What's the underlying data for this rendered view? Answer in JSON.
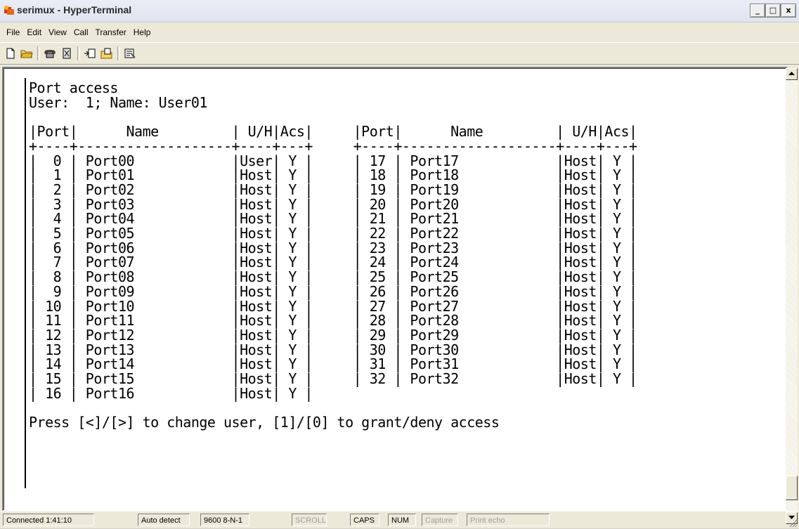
{
  "window": {
    "title": "serimux - HyperTerminal",
    "minimize": "_",
    "maximize": "□",
    "close": "x"
  },
  "menu": [
    "File",
    "Edit",
    "View",
    "Call",
    "Transfer",
    "Help"
  ],
  "toolbar": {
    "buttons": [
      {
        "name": "new-connection-icon"
      },
      {
        "name": "open-folder-icon"
      },
      {
        "name": "call-phone-icon"
      },
      {
        "name": "disconnect-icon"
      },
      {
        "name": "send-file-icon"
      },
      {
        "name": "receive-file-icon"
      },
      {
        "name": "properties-icon"
      }
    ]
  },
  "terminal": {
    "lines": [
      "Port access",
      "User:  1; Name: User01",
      "",
      "|Port|      Name         | U/H|Acs|     |Port|      Name         | U/H|Acs|",
      "+----+-------------------+----+---+     +----+-------------------+----+---+",
      "|  0 | Port00            |User| Y |     | 17 | Port17            |Host| Y |",
      "|  1 | Port01            |Host| Y |     | 18 | Port18            |Host| Y |",
      "|  2 | Port02            |Host| Y |     | 19 | Port19            |Host| Y |",
      "|  3 | Port03            |Host| Y |     | 20 | Port20            |Host| Y |",
      "|  4 | Port04            |Host| Y |     | 21 | Port21            |Host| Y |",
      "|  5 | Port05            |Host| Y |     | 22 | Port22            |Host| Y |",
      "|  6 | Port06            |Host| Y |     | 23 | Port23            |Host| Y |",
      "|  7 | Port07            |Host| Y |     | 24 | Port24            |Host| Y |",
      "|  8 | Port08            |Host| Y |     | 25 | Port25            |Host| Y |",
      "|  9 | Port09            |Host| Y |     | 26 | Port26            |Host| Y |",
      "| 10 | Port10            |Host| Y |     | 27 | Port27            |Host| Y |",
      "| 11 | Port11            |Host| Y |     | 28 | Port28            |Host| Y |",
      "| 12 | Port12            |Host| Y |     | 29 | Port29            |Host| Y |",
      "| 13 | Port13            |Host| Y |     | 30 | Port30            |Host| Y |",
      "| 14 | Port14            |Host| Y |     | 31 | Port31            |Host| Y |",
      "| 15 | Port15            |Host| Y |     | 32 | Port32            |Host| Y |",
      "| 16 | Port16            |Host| Y |",
      "",
      "Press [<]/[>] to change user, [1]/[0] to grant/deny access"
    ]
  },
  "statusbar": {
    "connected": "Connected 1:41:10",
    "detect": "Auto detect",
    "settings": "9600 8-N-1",
    "scroll": "SCROLL",
    "caps": "CAPS",
    "num": "NUM",
    "capture": "Capture",
    "print_echo": "Print echo"
  }
}
